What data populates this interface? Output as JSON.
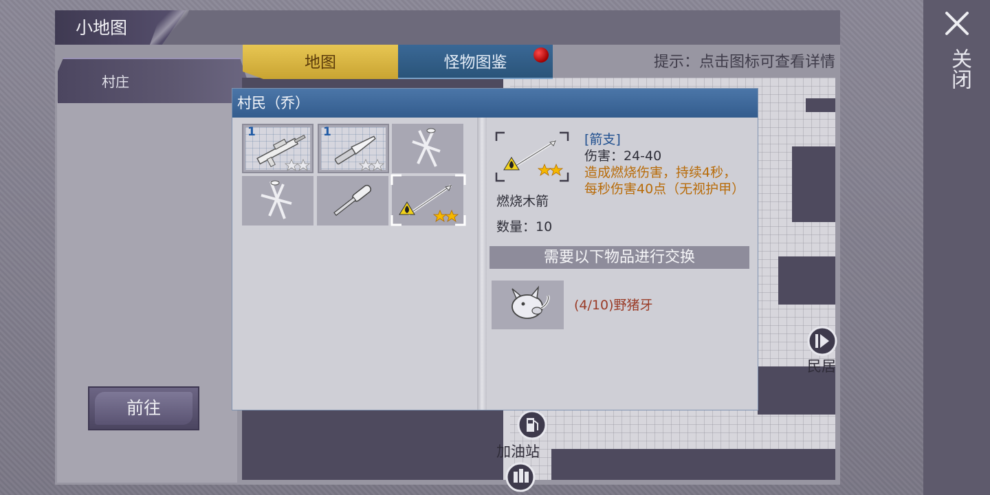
{
  "window": {
    "title": "小地图",
    "close_label": "关闭"
  },
  "left_panel": {
    "region": "村庄",
    "go_button": "前往"
  },
  "tabs": [
    {
      "label": "地图",
      "active": true
    },
    {
      "label": "怪物图鉴",
      "active": false,
      "has_notification": true
    }
  ],
  "hint": "提示：点击图标可查看详情",
  "map": {
    "labels": {
      "gas_station": "加油站",
      "residence": "民居"
    }
  },
  "dialog": {
    "title": "村民（乔）",
    "slots": [
      {
        "icon": "rifle-icon",
        "count": "1",
        "stars": 2
      },
      {
        "icon": "knife-icon",
        "count": "1",
        "stars": 2
      },
      {
        "icon": "nails-icon"
      },
      {
        "icon": "nails-icon"
      },
      {
        "icon": "screwdriver-icon"
      },
      {
        "icon": "burning-arrow-icon",
        "stars": 2,
        "selected": true
      }
    ],
    "item": {
      "category": "[箭支]",
      "damage": "伤害：24-40",
      "effect": "造成燃烧伤害，持续4秒，每秒伤害40点（无视护甲）",
      "name": "燃烧木箭",
      "quantity": "数量：10"
    },
    "exchange_title": "需要以下物品进行交换",
    "materials": [
      {
        "icon": "boar-tusk-icon",
        "text": "(4/10)野猪牙"
      }
    ]
  },
  "colors": {
    "active_tab": "#d9b640",
    "inactive_tab": "#2f5c86",
    "dialog_header": "#3f6a9c",
    "effect_text": "#b86b08",
    "material_text": "#9a3a25",
    "notification_dot": "#c00000"
  }
}
